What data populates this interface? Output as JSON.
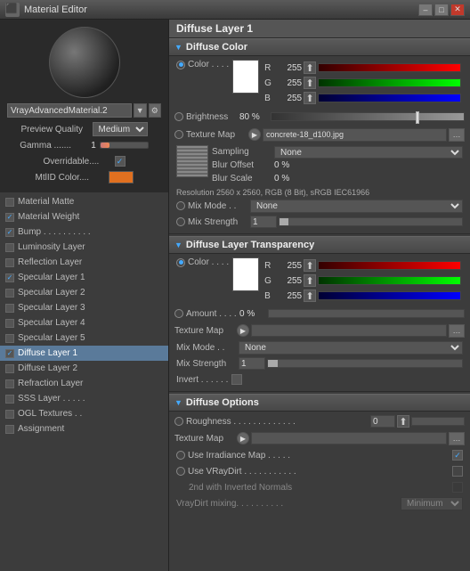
{
  "titleBar": {
    "title": "Material Editor",
    "icon": "⬛",
    "minimizeLabel": "–",
    "maximizeLabel": "□",
    "closeLabel": "✕"
  },
  "leftPanel": {
    "materialName": "VrayAdvancedMaterial.2",
    "previewQualityLabel": "Preview Quality",
    "previewQuality": "Medium",
    "gammaLabel": "Gamma .......",
    "gammaValue": "1",
    "overridableLabel": "Overridable....",
    "mtlIDLabel": "MtlID Color....",
    "layers": [
      {
        "name": "Material Matte",
        "checked": false,
        "active": false
      },
      {
        "name": "Material Weight",
        "checked": true,
        "active": false
      },
      {
        "name": "Bump . . . . . . . . . .",
        "checked": true,
        "active": false
      },
      {
        "name": "Luminosity Layer",
        "checked": false,
        "active": false
      },
      {
        "name": "Reflection Layer",
        "checked": false,
        "active": false
      },
      {
        "name": "Specular Layer 1",
        "checked": true,
        "active": false
      },
      {
        "name": "Specular Layer 2",
        "checked": false,
        "active": false
      },
      {
        "name": "Specular Layer 3",
        "checked": false,
        "active": false
      },
      {
        "name": "Specular Layer 4",
        "checked": false,
        "active": false
      },
      {
        "name": "Specular Layer 5",
        "checked": false,
        "active": false
      },
      {
        "name": "Diffuse Layer 1",
        "checked": true,
        "active": true
      },
      {
        "name": "Diffuse Layer 2",
        "checked": false,
        "active": false
      },
      {
        "name": "Refraction Layer",
        "checked": false,
        "active": false
      },
      {
        "name": "SSS Layer . . . . .",
        "checked": false,
        "active": false
      },
      {
        "name": "OGL Textures . .",
        "checked": false,
        "active": false
      },
      {
        "name": "Assignment",
        "checked": false,
        "active": false
      }
    ]
  },
  "rightPanel": {
    "mainTitle": "Diffuse Layer 1",
    "diffuseColor": {
      "sectionTitle": "Diffuse Color",
      "colorLabel": "Color . . . .",
      "r": 255,
      "g": 255,
      "b": 255,
      "brightnessLabel": "Brightness",
      "brightnessValue": "80 %",
      "brightnessPercent": 80,
      "textureMapLabel": "Texture Map",
      "textureFileName": "concrete-18_d100.jpg",
      "samplingLabel": "Sampling",
      "samplingValue": "None",
      "blurOffsetLabel": "Blur Offset",
      "blurOffsetValue": "0 %",
      "blurScaleLabel": "Blur Scale",
      "blurScaleValue": "0 %",
      "resolutionText": "Resolution 2560 x 2560, RGB (8 Bit), sRGB IEC61966",
      "mixModeLabel": "Mix Mode . .",
      "mixModeValue": "None",
      "mixStrengthLabel": "Mix Strength",
      "mixStrengthValue": "1"
    },
    "diffuseTransparency": {
      "sectionTitle": "Diffuse Layer Transparency",
      "colorLabel": "Color . . . .",
      "r": 255,
      "g": 255,
      "b": 255,
      "amountLabel": "Amount . . . .",
      "amountValue": "0 %",
      "textureMapLabel": "Texture Map",
      "mixModeLabel": "Mix Mode . .",
      "mixModeValue": "None",
      "mixStrengthLabel": "Mix Strength",
      "mixStrengthValue": "1",
      "invertLabel": "Invert . . . . . ."
    },
    "diffuseOptions": {
      "sectionTitle": "Diffuse Options",
      "roughnessLabel": "Roughness . . . . . . . . . . . . .",
      "roughnessValue": "0",
      "textureMapLabel": "Texture Map",
      "useIrrMapLabel": "Use Irradiance Map . . . . .",
      "useVRayDirtLabel": "Use VRayDirt . . . . . . . . . . .",
      "invertedNormalsLabel": "2nd with Inverted Normals",
      "vrayDirtMixingLabel": "VrayDirt mixing. . . . . . . . . .",
      "vrayDirtMixingValue": "Minimum"
    }
  }
}
